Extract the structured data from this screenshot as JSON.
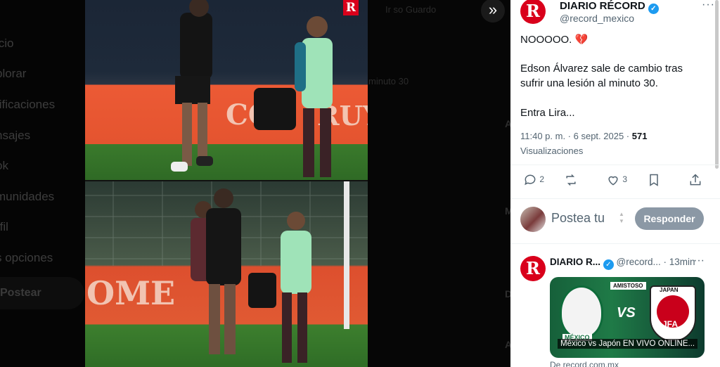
{
  "background_nav": {
    "items": [
      "icio",
      "plorar",
      "tificaciones",
      "nsajes",
      "ok",
      "munidades",
      "rfil",
      "s opciones"
    ],
    "post_label": "Postear"
  },
  "background_middle": {
    "top_text": "Ir so Guardo",
    "side_text": "minuto 30",
    "letters": [
      "A",
      "M",
      "D",
      "A"
    ]
  },
  "photo": {
    "logo_letter": "R",
    "ad_top": "CO",
    "ad_top_right": "RUYI",
    "ad_bottom": "OME"
  },
  "collapse_icon": "»",
  "tweet": {
    "author_name": "DIARIO RÉCORD",
    "author_handle": "@record_mexico",
    "avatar_letter": "R",
    "more": "···",
    "line1": "NOOOOO. 💔",
    "line2": "Edson Álvarez sale de cambio tras",
    "line3": "sufrir una lesión al minuto 30.",
    "line4": "Entra Lira...",
    "timestamp": "11:40 p. m. · 6 sept. 2025 ·",
    "views_count": "571",
    "views_label": "Visualizaciones",
    "actions": {
      "reply_count": "2",
      "retweet_count": "",
      "like_count": "3"
    }
  },
  "reply_box": {
    "placeholder": "Postea tu",
    "button_label": "Responder"
  },
  "reply2": {
    "avatar_letter": "R",
    "name": "DIARIO R...",
    "handle": "@record...",
    "time": "· 13min",
    "more": "···",
    "card": {
      "badge": "AMISTOSO",
      "vs": "VS",
      "mexico_label": "MÉXICO",
      "japan_label": "JAPAN",
      "jfa": "JFA",
      "caption": "México vs Japón EN VIVO ONLINE...",
      "source": "De record.com.mx"
    }
  },
  "colors": {
    "accent": "#1d9bf0",
    "brand_red": "#d9001b",
    "reply_button": "#8b98a5"
  }
}
